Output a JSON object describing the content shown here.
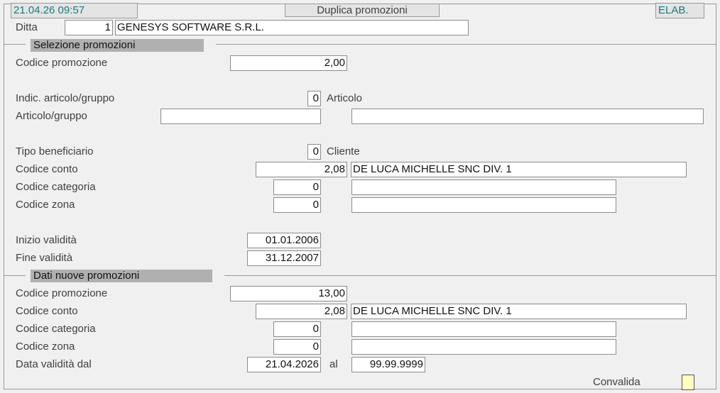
{
  "header": {
    "datetime": "21.04.26 09:57",
    "title": "Duplica promozioni",
    "mode": "ELAB."
  },
  "company": {
    "label": "Ditta",
    "code": "1",
    "name": "GENESYS SOFTWARE S.R.L."
  },
  "selection": {
    "section_title": "Selezione promozioni",
    "promo_code_label": "Codice promozione",
    "promo_code": "2,00",
    "article_indicator_label": "Indic. articolo/gruppo",
    "article_indicator_value": "0",
    "article_indicator_desc": "Articolo",
    "article_group_label": "Articolo/gruppo",
    "article_group_value": "",
    "article_group_desc": "",
    "beneficiary_type_label": "Tipo  beneficiario",
    "beneficiary_type_value": "0",
    "beneficiary_type_desc": "Cliente",
    "account_code_label": "Codice conto",
    "account_code": "2,08",
    "account_desc": "DE LUCA MICHELLE SNC DIV. 1",
    "category_code_label": "Codice categoria",
    "category_code": "0",
    "category_desc": "",
    "zone_code_label": "Codice zona",
    "zone_code": "0",
    "zone_desc": "",
    "valid_from_label": "Inizio validità",
    "valid_from": "01.01.2006",
    "valid_to_label": "Fine  validità",
    "valid_to": "31.12.2007"
  },
  "new_promos": {
    "section_title": "Dati nuove promozioni",
    "promo_code_label": "Codice promozione",
    "promo_code": "13,00",
    "account_code_label": "Codice conto",
    "account_code": "2,08",
    "account_desc": "DE LUCA MICHELLE SNC DIV. 1",
    "category_code_label": "Codice categoria",
    "category_code": "0",
    "category_desc": "",
    "zone_code_label": "Codice zona",
    "zone_code": "0",
    "zone_desc": "",
    "validity_label": "Data  validità dal",
    "validity_from": "21.04.2026",
    "validity_to_label": "al",
    "validity_to": "99.99.9999"
  },
  "footer": {
    "confirm_label": "Convalida"
  },
  "colors": {
    "teal_text": "#1a7a80",
    "section_header_bg": "#b0b0b0",
    "confirm_box": "#ffffc0"
  }
}
